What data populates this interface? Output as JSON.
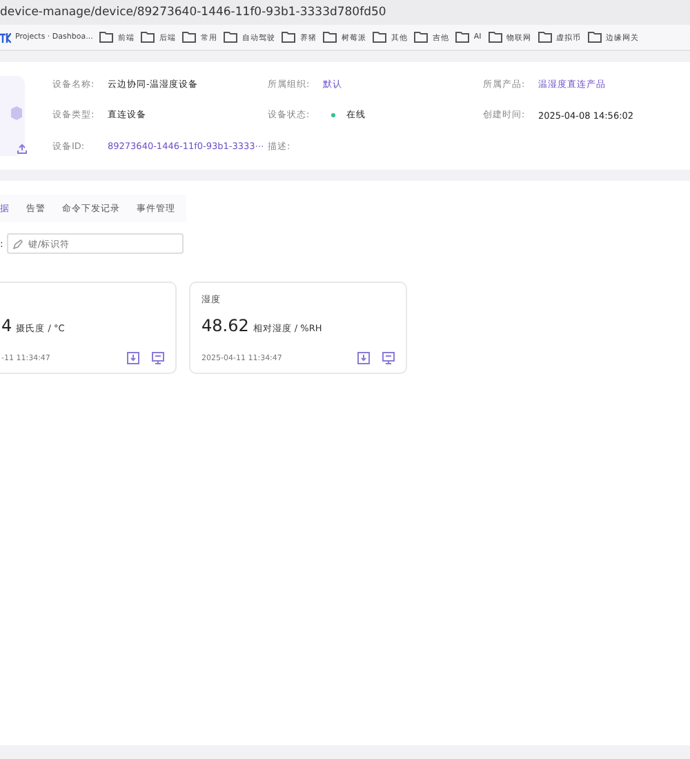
{
  "address_bar": {
    "url": "device-manage/device/89273640-1446-11f0-93b1-3333d780fd50"
  },
  "bookmarks": [
    {
      "kind": "site",
      "label": "Projects · Dashboa..."
    },
    {
      "kind": "folder",
      "label": "前端"
    },
    {
      "kind": "folder",
      "label": "后端"
    },
    {
      "kind": "folder",
      "label": "常用"
    },
    {
      "kind": "folder",
      "label": "自动驾驶"
    },
    {
      "kind": "folder",
      "label": "养猪"
    },
    {
      "kind": "folder",
      "label": "树莓派"
    },
    {
      "kind": "folder",
      "label": "其他"
    },
    {
      "kind": "folder",
      "label": "吉他"
    },
    {
      "kind": "folder",
      "label": "AI"
    },
    {
      "kind": "folder",
      "label": "物联网"
    },
    {
      "kind": "folder",
      "label": "虚拟币"
    },
    {
      "kind": "folder",
      "label": "边缘网关"
    }
  ],
  "device_info": [
    {
      "label": "设备名称:",
      "value": "云边协同-温湿度设备",
      "kind": "text"
    },
    {
      "label": "所属组织:",
      "value": "默认",
      "kind": "link"
    },
    {
      "label": "所属产品:",
      "value": "温湿度直连产品",
      "kind": "link"
    },
    {
      "label": "设备类型:",
      "value": "直连设备",
      "kind": "text"
    },
    {
      "label": "设备状态:",
      "value": "在线",
      "kind": "status",
      "color": "#2ec28f"
    },
    {
      "label": "创建时间:",
      "value": "2025-04-08 14:56:02",
      "kind": "text"
    },
    {
      "label": "设备ID:",
      "value": "89273640-1446-11f0-93b1-3333⋯",
      "kind": "link"
    },
    {
      "label": "描述:"
    }
  ],
  "tabs": [
    {
      "label": "据",
      "selected": true
    },
    {
      "label": "告警",
      "selected": false
    },
    {
      "label": "命令下发记录",
      "selected": false
    },
    {
      "label": "事件管理",
      "selected": false
    }
  ],
  "search": {
    "label": ":",
    "placeholder": "键/标识符"
  },
  "cards": [
    {
      "value": "4",
      "unit": "摄氏度 / °C",
      "time": "-11 11:34:47"
    },
    {
      "title": "湿度",
      "value": "48.62",
      "unit": "相对湿度 / %RH",
      "time": "2025-04-11 11:34:47"
    }
  ]
}
